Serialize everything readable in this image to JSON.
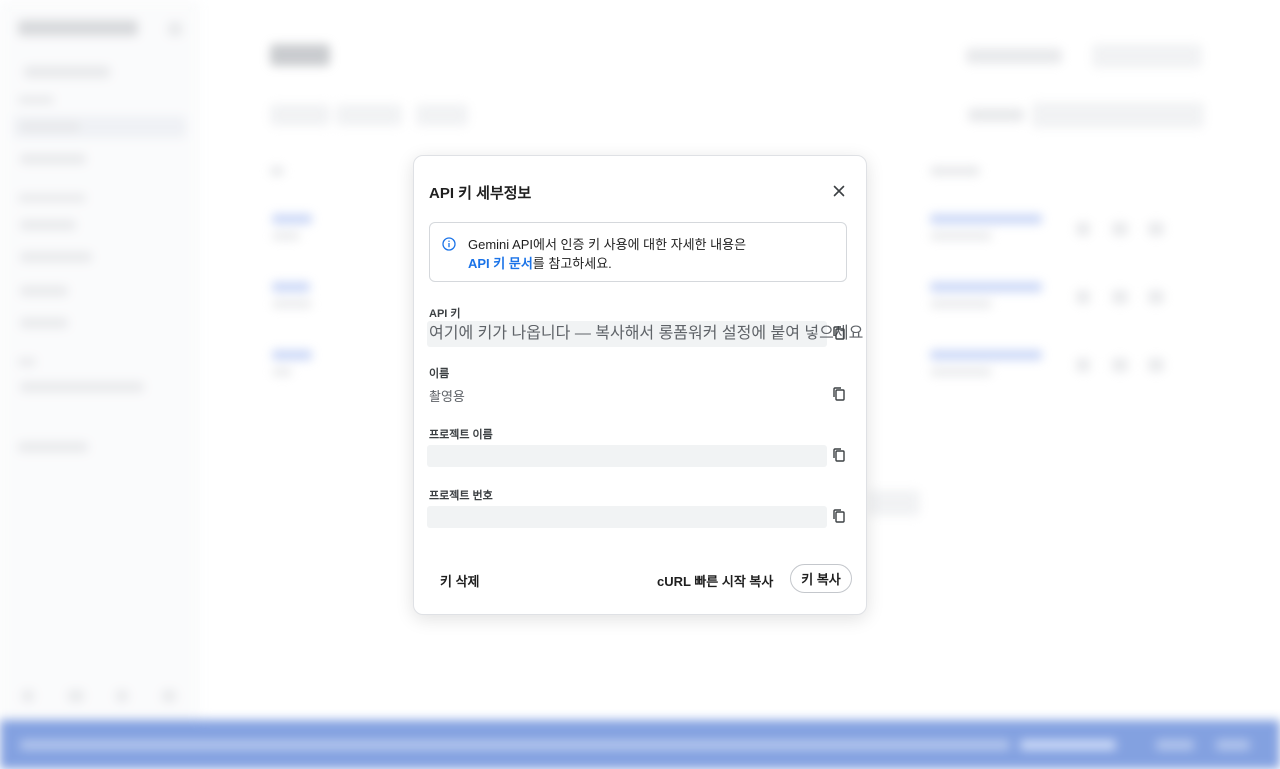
{
  "dialog": {
    "title": "API 키 세부정보",
    "close_icon": "close-icon",
    "info": {
      "icon": "info-icon",
      "text_line1": "Gemini API에서 인증 키 사용에 대한 자세한 내용은",
      "link_text": "API 키 문서",
      "text_line2_suffix": "를 참고하세요."
    },
    "fields": {
      "api_key": {
        "label": "API 키",
        "value": "여기에 키가 나옵니다 — 복사해서 롱폼워커 설정에 붙여 넣으세요"
      },
      "name": {
        "label": "이름",
        "value": "촬영용"
      },
      "project_name": {
        "label": "프로젝트 이름",
        "value": ""
      },
      "project_number": {
        "label": "프로젝트 번호",
        "value": ""
      }
    },
    "buttons": {
      "delete_key": "키 삭제",
      "copy_curl": "cURL 빠른 시작 복사",
      "copy_key": "키 복사"
    }
  },
  "colors": {
    "accent_link": "#1a73e8",
    "footer_bar": "#1f55c8"
  }
}
